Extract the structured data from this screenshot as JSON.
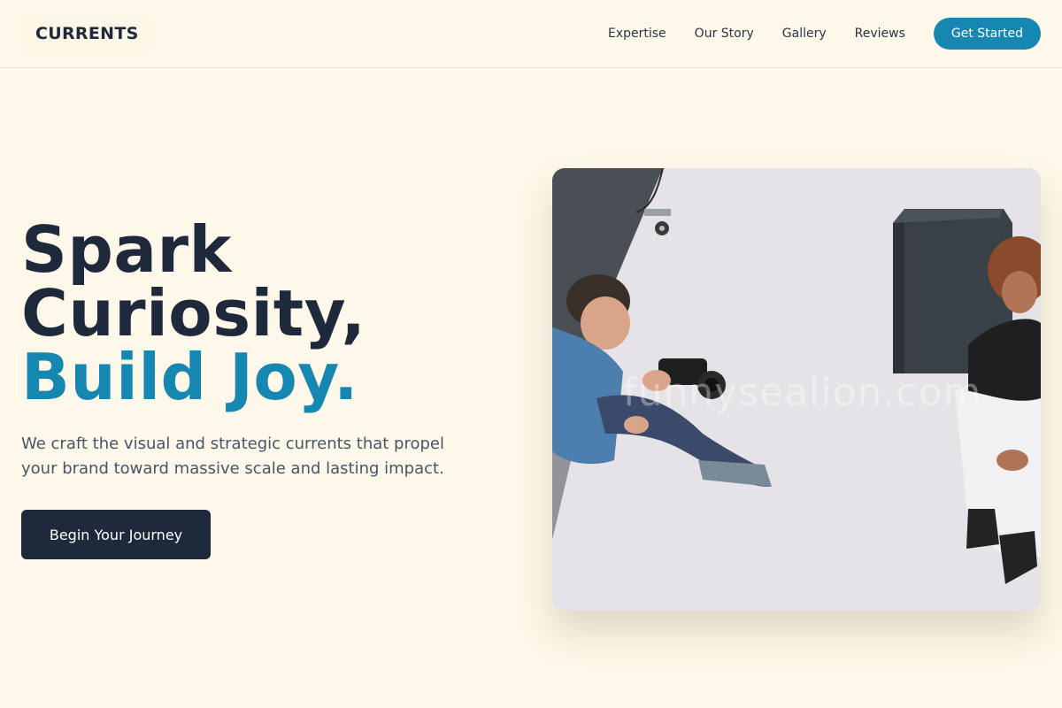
{
  "brand": {
    "logo_text": "CURRENTS"
  },
  "nav": {
    "links": [
      "Expertise",
      "Our Story",
      "Gallery",
      "Reviews"
    ],
    "cta_label": "Get Started"
  },
  "hero": {
    "title_line1": "Spark",
    "title_line2": "Curiosity,",
    "title_line3": "Build Joy.",
    "subtitle": "We craft the visual and strategic currents that propel your brand toward massive scale and lasting impact.",
    "button_label": "Begin Your Journey",
    "image_watermark": "funnysealion.com"
  },
  "colors": {
    "background": "#fef8ea",
    "primary_dark": "#1e293b",
    "accent": "#1587b0",
    "body_text": "#475569"
  },
  "icons": []
}
